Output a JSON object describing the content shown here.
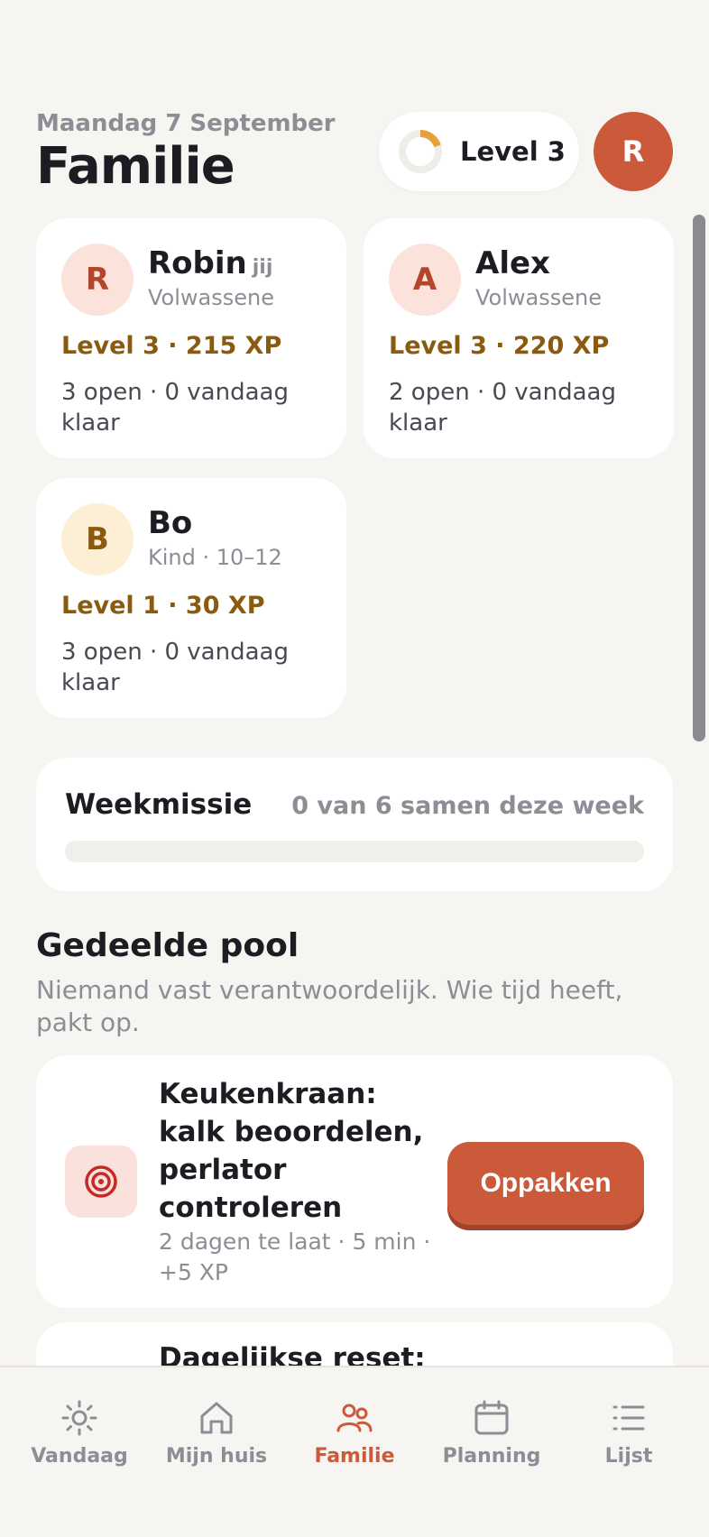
{
  "header": {
    "date": "Maandag 7 September",
    "title": "Familie",
    "level_label": "Level 3",
    "level_progress": 0.2,
    "avatar_initial": "R"
  },
  "members": [
    {
      "initial": "R",
      "name": "Robin",
      "you": "jij",
      "role": "Volwassene",
      "level": "Level 3 · 215 XP",
      "stats": "3 open · 0 vandaag klaar",
      "avatar_bg": "#fbe3dc",
      "avatar_fg": "#b2452c"
    },
    {
      "initial": "A",
      "name": "Alex",
      "you": "",
      "role": "Volwassene",
      "level": "Level 3 · 220 XP",
      "stats": "2 open · 0 vandaag klaar",
      "avatar_bg": "#fbe3dc",
      "avatar_fg": "#b2452c"
    },
    {
      "initial": "B",
      "name": "Bo",
      "you": "",
      "role": "Kind · 10–12",
      "level": "Level 1 · 30 XP",
      "stats": "3 open · 0 vandaag klaar",
      "avatar_bg": "#fcefd6",
      "avatar_fg": "#8a5a0e"
    }
  ],
  "mission": {
    "title": "Weekmissie",
    "count": "0 van 6 samen deze week",
    "progress": 0
  },
  "pool": {
    "title": "Gedeelde pool",
    "subtitle": "Niemand vast verantwoordelijk. Wie tijd heeft, pakt op."
  },
  "tasks": [
    {
      "title": "Keukenkraan: kalk beoordelen, perlator controleren",
      "meta": "2 dagen te laat · 5 min · +5 XP",
      "action": "Oppakken",
      "icon": "target-icon"
    },
    {
      "title": "Dagelijkse reset:",
      "meta": "",
      "action": "",
      "icon": ""
    }
  ],
  "nav": [
    {
      "label": "Vandaag",
      "icon": "sun-icon",
      "active": false
    },
    {
      "label": "Mijn huis",
      "icon": "home-icon",
      "active": false
    },
    {
      "label": "Familie",
      "icon": "family-icon",
      "active": true
    },
    {
      "label": "Planning",
      "icon": "calendar-icon",
      "active": false
    },
    {
      "label": "Lijst",
      "icon": "list-icon",
      "active": false
    }
  ],
  "colors": {
    "accent": "#cb5a3b",
    "xp_gold": "#8a5a0e",
    "ring": "#e7a13a",
    "muted": "#8f8c95",
    "background": "#f6f5f1"
  }
}
